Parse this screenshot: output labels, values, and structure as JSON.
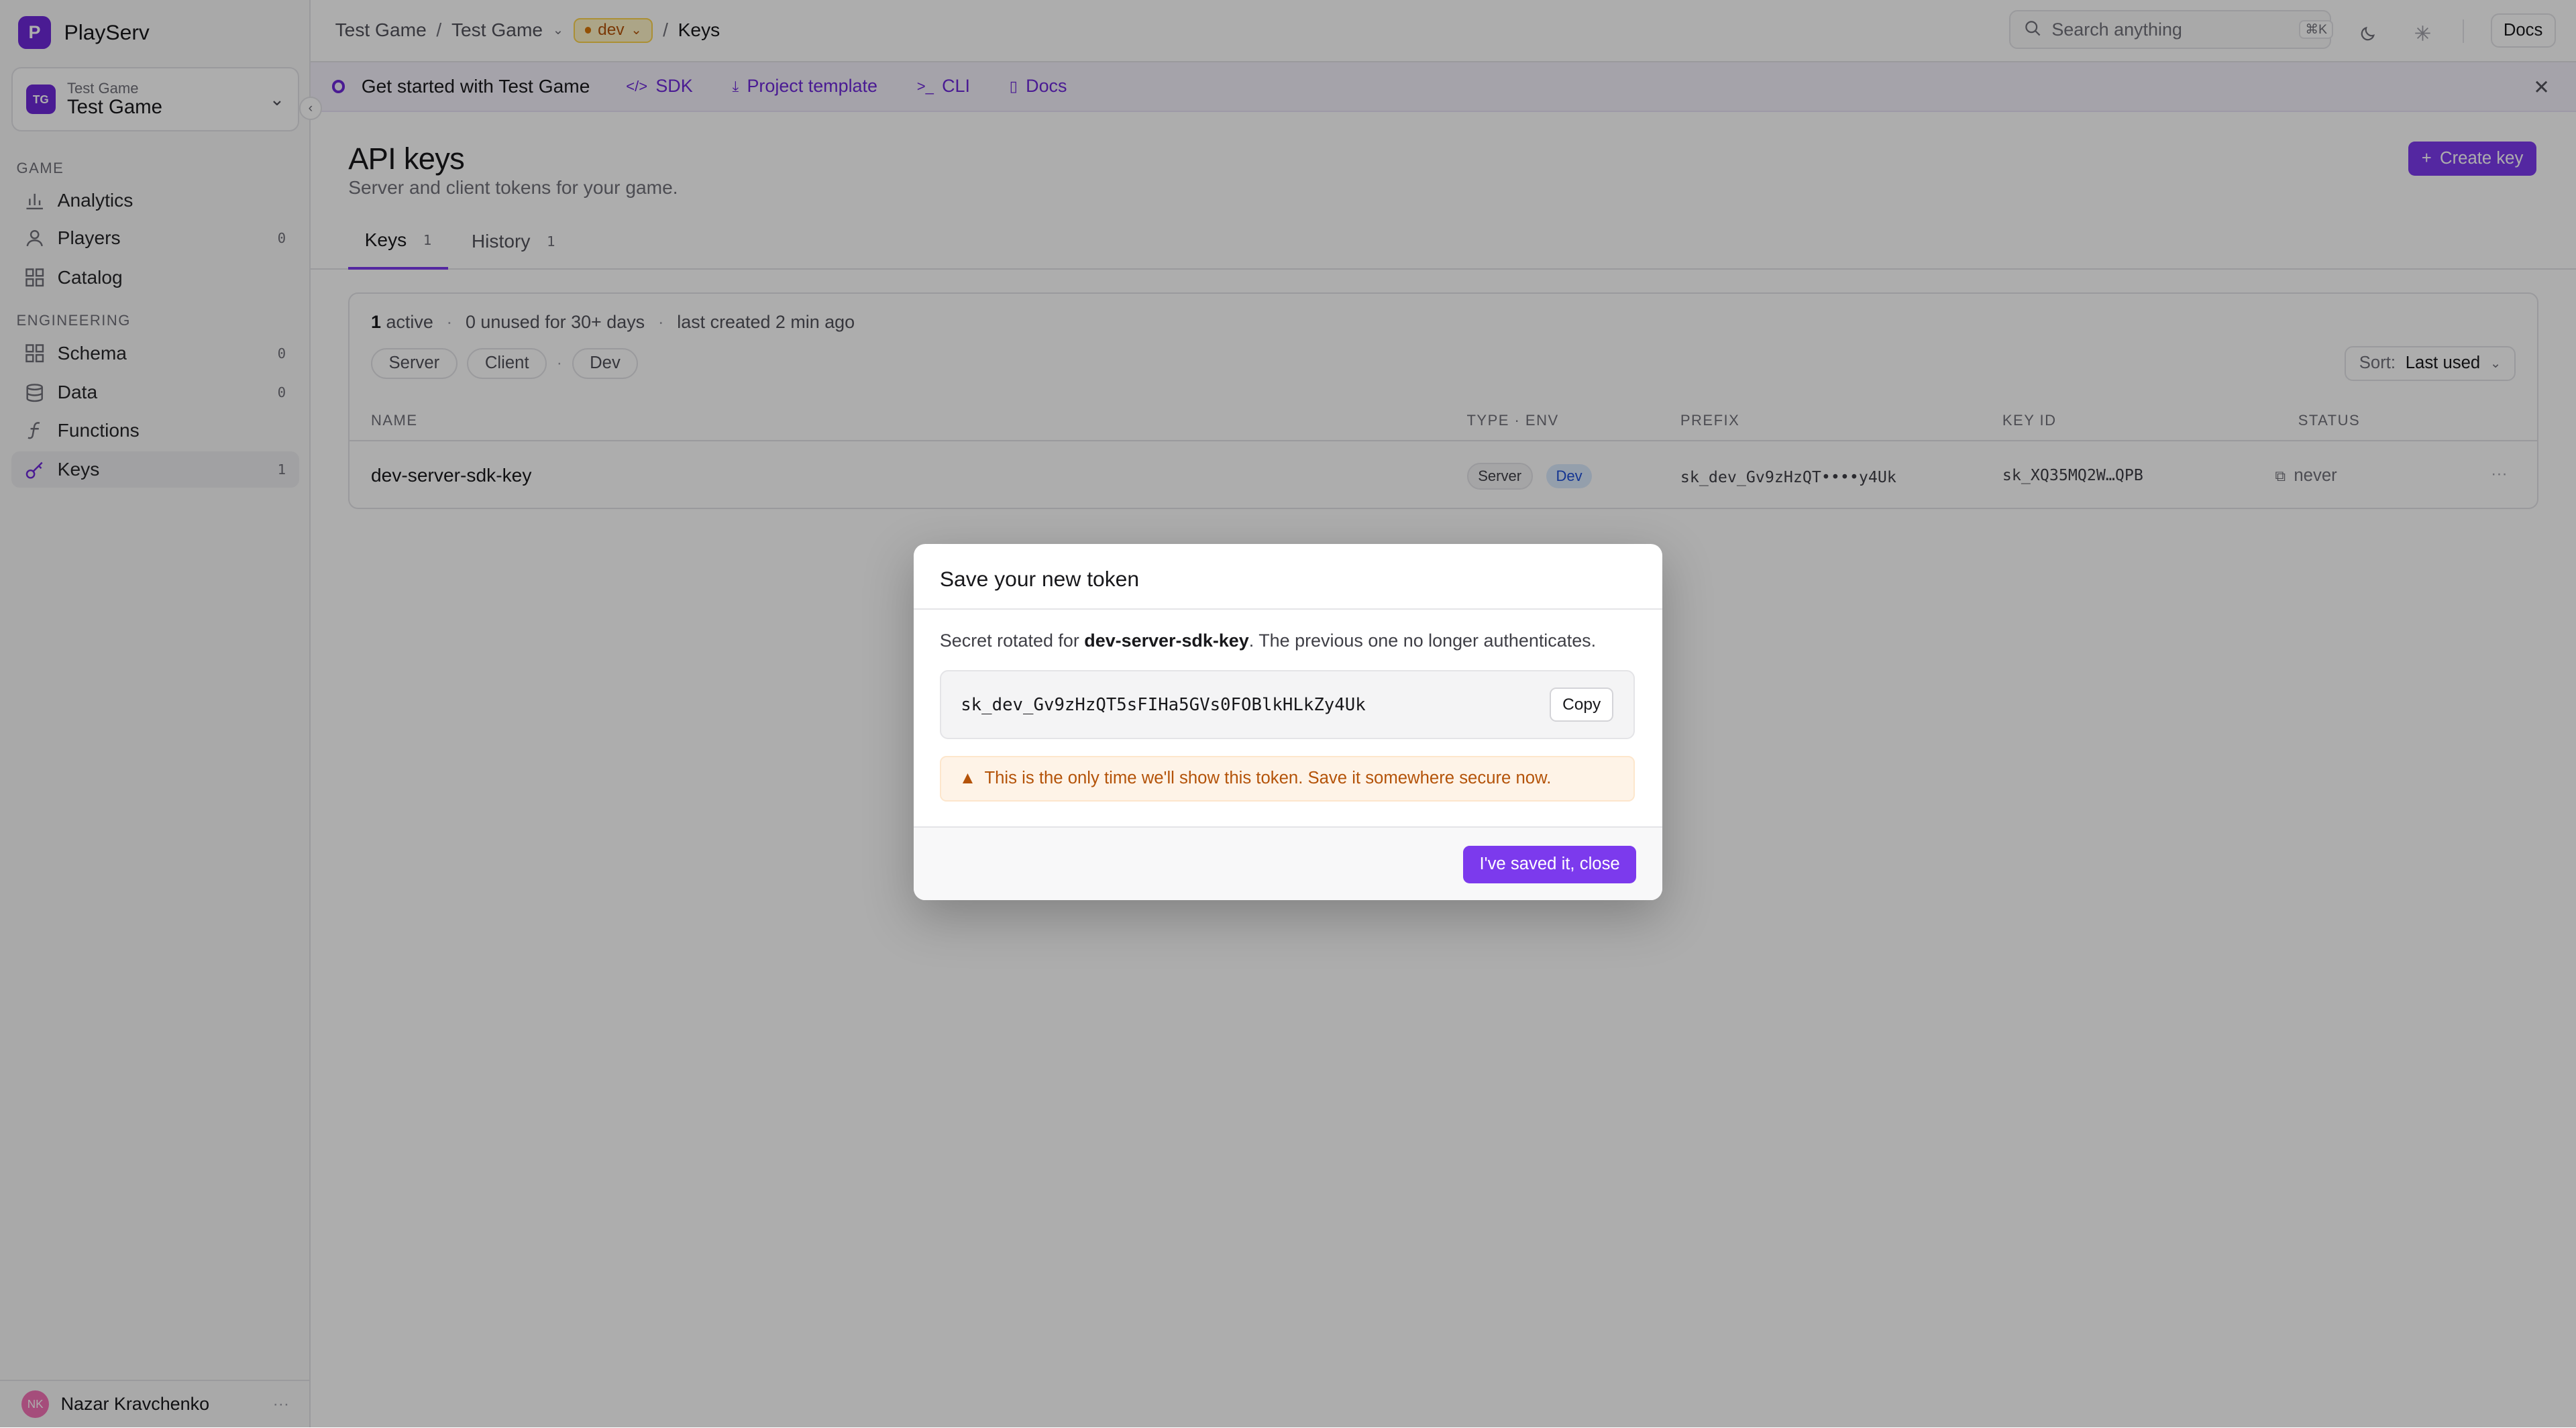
{
  "app": {
    "name": "PlayServ",
    "logo_letter": "P",
    "accent": "#7c3aed"
  },
  "project": {
    "label": "Test Game",
    "name": "Test Game",
    "initials": "TG"
  },
  "sidebar": {
    "sections": [
      {
        "title": "GAME",
        "items": [
          {
            "label": "Analytics",
            "icon": "bar-chart-icon",
            "count": ""
          },
          {
            "label": "Players",
            "icon": "user-icon",
            "count": "0"
          },
          {
            "label": "Catalog",
            "icon": "grid-icon",
            "count": ""
          }
        ]
      },
      {
        "title": "ENGINEERING",
        "items": [
          {
            "label": "Schema",
            "icon": "grid-icon",
            "count": "0"
          },
          {
            "label": "Data",
            "icon": "database-icon",
            "count": "0"
          },
          {
            "label": "Functions",
            "icon": "function-icon",
            "count": ""
          },
          {
            "label": "Keys",
            "icon": "key-icon",
            "count": "1",
            "active": true
          }
        ]
      }
    ],
    "user": {
      "name": "Nazar Kravchenko",
      "initials": "NK"
    }
  },
  "topbar": {
    "breadcrumb": [
      "Test Game",
      "Test Game",
      "dev",
      "Keys"
    ],
    "search_placeholder": "Search anything",
    "search_shortcut": "⌘K",
    "docs_label": "Docs"
  },
  "banner": {
    "title": "Get started with Test Game",
    "links": [
      "SDK",
      "Project template",
      "CLI",
      "Docs"
    ]
  },
  "page": {
    "title": "API keys",
    "subtitle": "Server and client tokens for your game.",
    "create_label": "Create key",
    "tabs": [
      {
        "label": "Keys",
        "count": "1",
        "active": true
      },
      {
        "label": "History",
        "count": "1"
      }
    ]
  },
  "summary": {
    "active_count": "1",
    "active_label": "active",
    "unused": "0 unused for 30+ days",
    "last_created": "last created 2 min ago",
    "filters": [
      "Server",
      "Client",
      "Dev"
    ],
    "sort_label": "Sort:",
    "sort_value": "Last used"
  },
  "table": {
    "columns": [
      "NAME",
      "TYPE · ENV",
      "PREFIX",
      "KEY ID",
      "STATUS"
    ],
    "rows": [
      {
        "name": "dev-server-sdk-key",
        "type": "Server",
        "env": "Dev",
        "prefix": "sk_dev_Gv9zHzQT••••y4Uk",
        "key_id": "sk_XQ35MQ2W…QPB",
        "status": "never"
      }
    ]
  },
  "modal": {
    "title": "Save your new token",
    "desc_prefix": "Secret rotated for ",
    "desc_key": "dev-server-sdk-key",
    "desc_suffix": ". The previous one no longer authenticates.",
    "token": "sk_dev_Gv9zHzQT5sFIHa5GVs0FOBlkHLkZy4Uk",
    "copy_label": "Copy",
    "warning": "This is the only time we'll show this token. Save it somewhere secure now.",
    "confirm_label": "I've saved it, close"
  }
}
